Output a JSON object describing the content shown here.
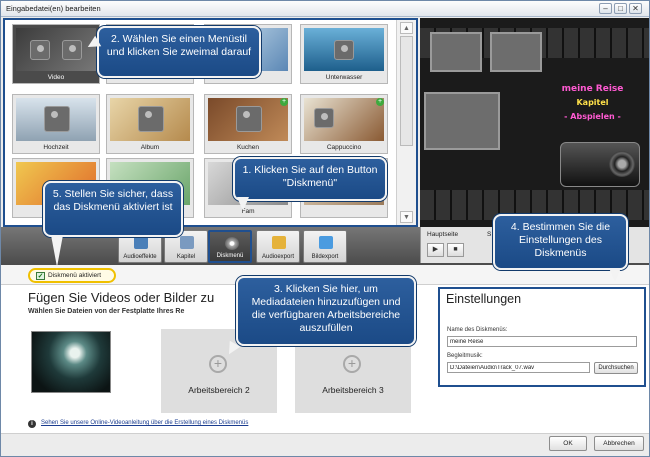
{
  "window": {
    "title": "Eingabedatei(en) bearbeiten",
    "minimize": "–",
    "maximize": "□",
    "close": "✕"
  },
  "menu_styles": [
    {
      "label": "Video",
      "selected": true
    },
    {
      "label": "",
      "selected": false
    },
    {
      "label": "",
      "selected": false
    },
    {
      "label": "Unterwasser",
      "selected": false
    },
    {
      "label": "",
      "selected": false
    },
    {
      "label": "",
      "selected": false
    },
    {
      "label": "",
      "selected": false
    },
    {
      "label": "",
      "selected": false
    },
    {
      "label": "Hochzeit",
      "selected": false
    },
    {
      "label": "Album",
      "selected": false
    },
    {
      "label": "Kuchen",
      "selected": false
    },
    {
      "label": "Cappuccino",
      "selected": false
    },
    {
      "label": "",
      "selected": false
    },
    {
      "label": "",
      "selected": false
    },
    {
      "label": "Fam",
      "selected": false
    },
    {
      "label": "",
      "selected": false
    }
  ],
  "preview": {
    "title_line": "meine Reise",
    "chapter": "Kapitel",
    "play": "- Abspielen -"
  },
  "toolbar": {
    "buttons": [
      {
        "label": "Audioeffekte"
      },
      {
        "label": "Kapitel"
      },
      {
        "label": "Diskmenü"
      },
      {
        "label": "Audioexport"
      },
      {
        "label": "Bildexport"
      }
    ]
  },
  "player": {
    "tab": "Hauptseite",
    "play_icon": "▶",
    "stop_icon": "■",
    "s_label": "S"
  },
  "disc_menu_toggle": {
    "checked": true,
    "label": "Diskmenü aktiviert",
    "check_glyph": "✓"
  },
  "content": {
    "heading": "Fügen Sie Videos oder Bilder zu",
    "subheading": "Wählen Sie Dateien von der Festplatte Ihres Re",
    "areas": [
      {
        "label": "Arbeitsbereich 2",
        "plus": "+"
      },
      {
        "label": "Arbeitsbereich 3",
        "plus": "+"
      }
    ]
  },
  "settings": {
    "title": "Einstellungen",
    "menu_name_label": "Name des Diskmenüs:",
    "menu_name_value": "meine Reise",
    "music_label": "Begleitmusik:",
    "music_value": "D:\\Dateien\\Audio\\Track_07.wav",
    "browse_button": "Durchsuchen"
  },
  "info": {
    "icon": "i",
    "link_text": "Sehen Sie unsere Online-Videoanleitung über die Erstellung eines Diskmenüs"
  },
  "footer": {
    "ok": "OK",
    "cancel": "Abbrechen"
  },
  "callouts": {
    "c1": "1. Klicken Sie auf den Button \"Diskmenü\"",
    "c2": "2. Wählen Sie einen Menüstil und klicken Sie zweimal darauf",
    "c3": "3. Klicken Sie hier, um Mediadateien hinzuzufügen und die verfügbaren Arbeitsbereiche auszufüllen",
    "c4": "4. Bestimmen Sie die Einstellungen des Diskmenüs",
    "c5": "5. Stellen Sie sicher, dass das Diskmenü aktiviert ist"
  },
  "colors": {
    "callout_blue": "#1f4f8f",
    "highlight_yellow": "#f0c000"
  }
}
